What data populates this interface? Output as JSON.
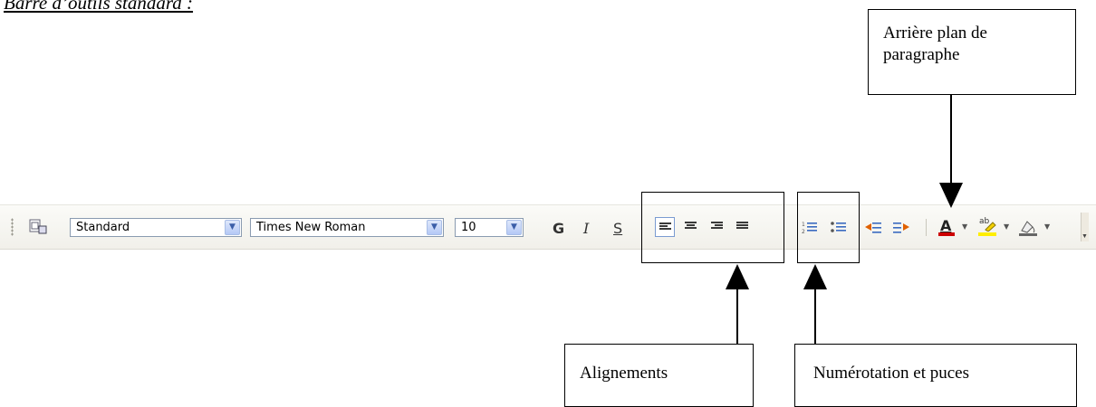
{
  "heading": "Barre d’outils standard :",
  "toolbar": {
    "style_value": "Standard",
    "font_value": "Times New Roman",
    "size_value": "10",
    "bold_label": "G",
    "italic_label": "I",
    "underline_label": "S",
    "font_color_glyph": "A",
    "highlight_glyph": "ab",
    "icons": [
      "styles-icon",
      "align-left-icon",
      "align-center-icon",
      "align-right-icon",
      "justify-icon",
      "numbering-icon",
      "bullets-icon",
      "decrease-indent-icon",
      "increase-indent-icon",
      "font-color-icon",
      "highlight-icon",
      "paragraph-background-icon"
    ]
  },
  "callouts": {
    "background": "Arrière plan de paragraphe",
    "alignments": "Alignements",
    "numbering": "Numérotation et puces"
  },
  "colors": {
    "font_color_bar": "#cc0000",
    "highlight_bar": "#ffee00",
    "combo_arrow": "#b4c8f6"
  }
}
